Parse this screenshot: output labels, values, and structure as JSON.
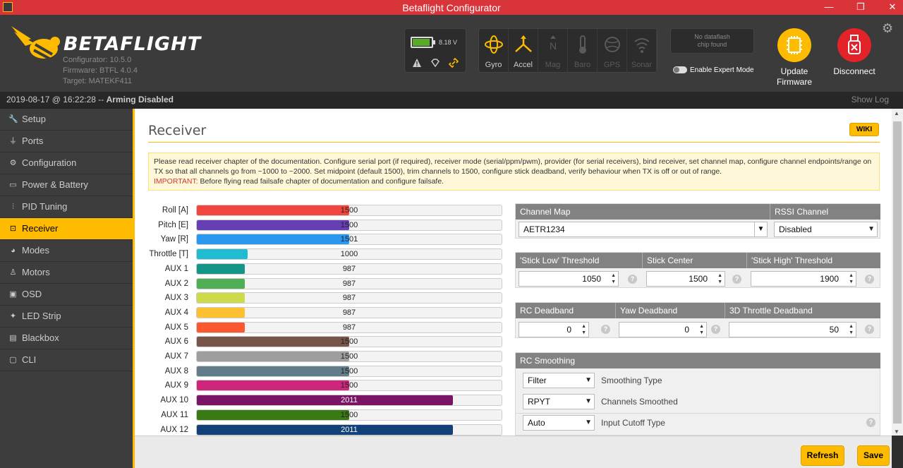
{
  "window": {
    "title": "Betaflight Configurator",
    "minimize": "—",
    "maximize": "❐",
    "close": "✕"
  },
  "header": {
    "brand": "BETAFLIGHT",
    "configurator_version": "Configurator: 10.5.0",
    "firmware": "Firmware: BTFL 4.0.4",
    "target": "Target: MATEKF411",
    "battery_voltage": "8.18 V",
    "battery_level": 0.85,
    "sensors": [
      {
        "label": "Gyro",
        "icon": "gyro-icon",
        "active": true
      },
      {
        "label": "Accel",
        "icon": "accel-icon",
        "active": true
      },
      {
        "label": "Mag",
        "icon": "mag-icon",
        "active": false
      },
      {
        "label": "Baro",
        "icon": "baro-icon",
        "active": false
      },
      {
        "label": "GPS",
        "icon": "gps-icon",
        "active": false
      },
      {
        "label": "Sonar",
        "icon": "sonar-icon",
        "active": false
      }
    ],
    "dataflash_line1": "No dataflash",
    "dataflash_line2": "chip found",
    "expert_mode": "Enable Expert Mode",
    "update_firmware": "Update Firmware",
    "disconnect": "Disconnect",
    "accent": "#ffbb00",
    "danger": "#e2232a"
  },
  "status": {
    "timestamp": "2019-08-17 @ 16:22:28",
    "separator": " -- ",
    "state": "Arming Disabled",
    "show_log": "Show Log"
  },
  "sidebar": {
    "items": [
      {
        "label": "Setup",
        "icon": "wrench-icon",
        "active": false
      },
      {
        "label": "Ports",
        "icon": "plug-icon",
        "active": false
      },
      {
        "label": "Configuration",
        "icon": "gear-icon",
        "active": false
      },
      {
        "label": "Power & Battery",
        "icon": "battery-icon",
        "active": false
      },
      {
        "label": "PID Tuning",
        "icon": "sliders-icon",
        "active": false
      },
      {
        "label": "Receiver",
        "icon": "receiver-icon",
        "active": true
      },
      {
        "label": "Modes",
        "icon": "modes-icon",
        "active": false
      },
      {
        "label": "Motors",
        "icon": "motor-icon",
        "active": false
      },
      {
        "label": "OSD",
        "icon": "osd-icon",
        "active": false
      },
      {
        "label": "LED Strip",
        "icon": "led-icon",
        "active": false
      },
      {
        "label": "Blackbox",
        "icon": "blackbox-icon",
        "active": false
      },
      {
        "label": "CLI",
        "icon": "cli-icon",
        "active": false
      }
    ]
  },
  "main": {
    "title": "Receiver",
    "wiki": "WIKI",
    "notice_text": "Please read receiver chapter of the documentation. Configure serial port (if required), receiver mode (serial/ppm/pwm), provider (for serial receivers), bind receiver, set channel map, configure channel endpoints/range on TX so that all channels go from ~1000 to ~2000. Set midpoint (default 1500), trim channels to 1500, configure stick deadband, verify behaviour when TX is off or out of range.",
    "notice_important": "IMPORTANT:",
    "notice_important_text": " Before flying read failsafe chapter of documentation and configure failsafe.",
    "channels": [
      {
        "name": "Roll [A]",
        "value": 1500,
        "color": "#f1453d"
      },
      {
        "name": "Pitch [E]",
        "value": 1500,
        "color": "#673fb4"
      },
      {
        "name": "Yaw [R]",
        "value": 1501,
        "color": "#2b98f0"
      },
      {
        "name": "Throttle [T]",
        "value": 1000,
        "color": "#1fbcd2"
      },
      {
        "name": "AUX 1",
        "value": 987,
        "color": "#159588"
      },
      {
        "name": "AUX 2",
        "value": 987,
        "color": "#50ae55"
      },
      {
        "name": "AUX 3",
        "value": 987,
        "color": "#cdda49"
      },
      {
        "name": "AUX 4",
        "value": 987,
        "color": "#fdc02f"
      },
      {
        "name": "AUX 5",
        "value": 987,
        "color": "#fc5830"
      },
      {
        "name": "AUX 6",
        "value": 1500,
        "color": "#785549"
      },
      {
        "name": "AUX 7",
        "value": 1500,
        "color": "#9e9e9e"
      },
      {
        "name": "AUX 8",
        "value": 1500,
        "color": "#617d8a"
      },
      {
        "name": "AUX 9",
        "value": 1500,
        "color": "#cf267d"
      },
      {
        "name": "AUX 10",
        "value": 2011,
        "color": "#7a1464"
      },
      {
        "name": "AUX 11",
        "value": 1500,
        "color": "#3a7a14"
      },
      {
        "name": "AUX 12",
        "value": 2011,
        "color": "#14407a"
      }
    ],
    "channel_map": {
      "label": "Channel Map",
      "value": "AETR1234"
    },
    "rssi": {
      "label": "RSSI Channel",
      "value": "Disabled"
    },
    "thresholds": {
      "low_label": "'Stick Low' Threshold",
      "low": "1050",
      "center_label": "Stick Center",
      "center": "1500",
      "high_label": "'Stick High' Threshold",
      "high": "1900"
    },
    "deadbands": {
      "rc_label": "RC Deadband",
      "rc": "0",
      "yaw_label": "Yaw Deadband",
      "yaw": "0",
      "throttle_label": "3D Throttle Deadband",
      "throttle": "50"
    },
    "smoothing": {
      "label": "RC Smoothing",
      "type_value": "Filter",
      "type_label": "Smoothing Type",
      "channels_value": "RPYT",
      "channels_label": "Channels Smoothed",
      "cutoff_value": "Auto",
      "cutoff_label": "Input Cutoff Type"
    }
  },
  "footer": {
    "refresh": "Refresh",
    "save": "Save"
  }
}
